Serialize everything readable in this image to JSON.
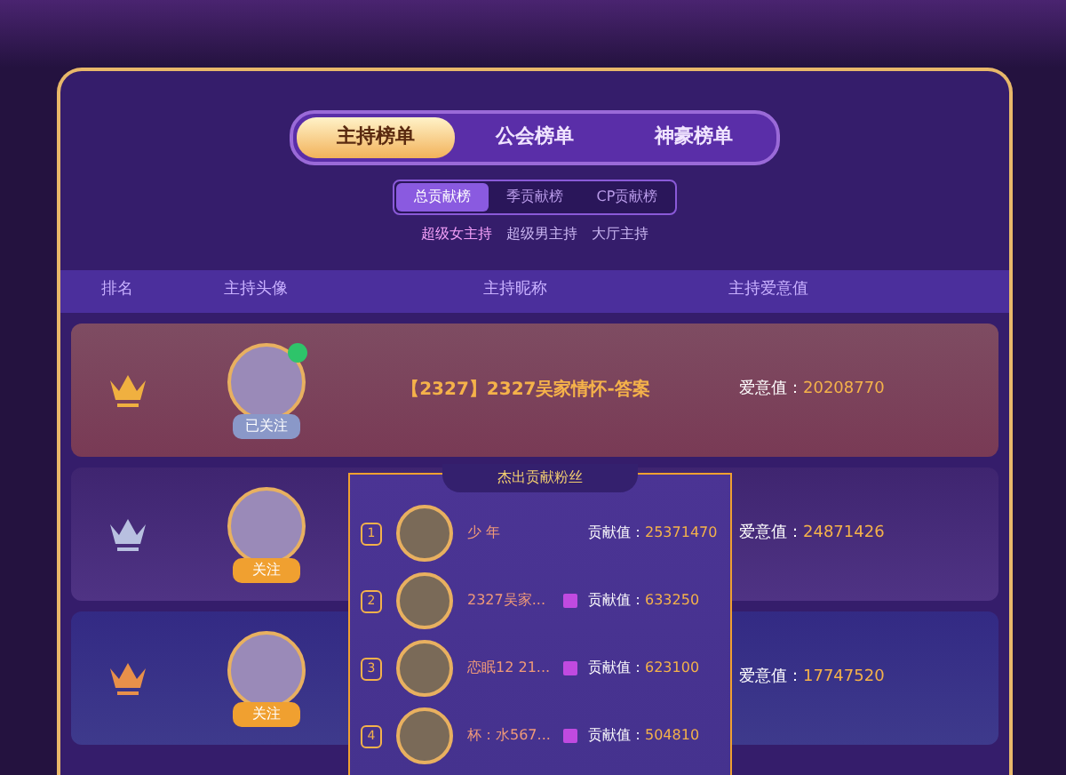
{
  "main_tabs": [
    {
      "label": "主持榜单",
      "selected": true
    },
    {
      "label": "公会榜单",
      "selected": false
    },
    {
      "label": "神豪榜单",
      "selected": false
    }
  ],
  "sub_tabs": [
    {
      "label": "总贡献榜",
      "selected": true
    },
    {
      "label": "季贡献榜",
      "selected": false
    },
    {
      "label": "CP贡献榜",
      "selected": false
    }
  ],
  "filters": [
    {
      "label": "超级女主持",
      "selected": true
    },
    {
      "label": "超级男主持",
      "selected": false
    },
    {
      "label": "大厅主持",
      "selected": false
    }
  ],
  "table": {
    "columns": [
      "排名",
      "主持头像",
      "主持昵称",
      "主持爱意值"
    ],
    "rows": [
      {
        "kind": "gold",
        "live": true,
        "follow": "已关注",
        "followed": true,
        "name": "【2327】2327吴家情怀-答案",
        "value_label": "爱意值：",
        "value": "20208770"
      },
      {
        "kind": "silver",
        "live": false,
        "follow": "关注",
        "followed": false,
        "value_label": "爱意值：",
        "value": "24871426"
      },
      {
        "kind": "bronze",
        "live": false,
        "follow": "关注",
        "followed": false,
        "value_label": "爱意值：",
        "value": "17747520"
      }
    ]
  },
  "popup": {
    "title": "杰出贡献粉丝",
    "fans": [
      {
        "rank": "1",
        "name": "少 年",
        "badge": false,
        "value_label": "贡献值：",
        "value": "25371470"
      },
      {
        "rank": "2",
        "name": "2327吴家...",
        "badge": true,
        "value_label": "贡献值：",
        "value": "633250"
      },
      {
        "rank": "3",
        "name": "恋眠12 21...",
        "badge": true,
        "value_label": "贡献值：",
        "value": "623100"
      },
      {
        "rank": "4",
        "name": "杯：水567...",
        "badge": true,
        "value_label": "贡献值：",
        "value": "504810"
      }
    ]
  }
}
